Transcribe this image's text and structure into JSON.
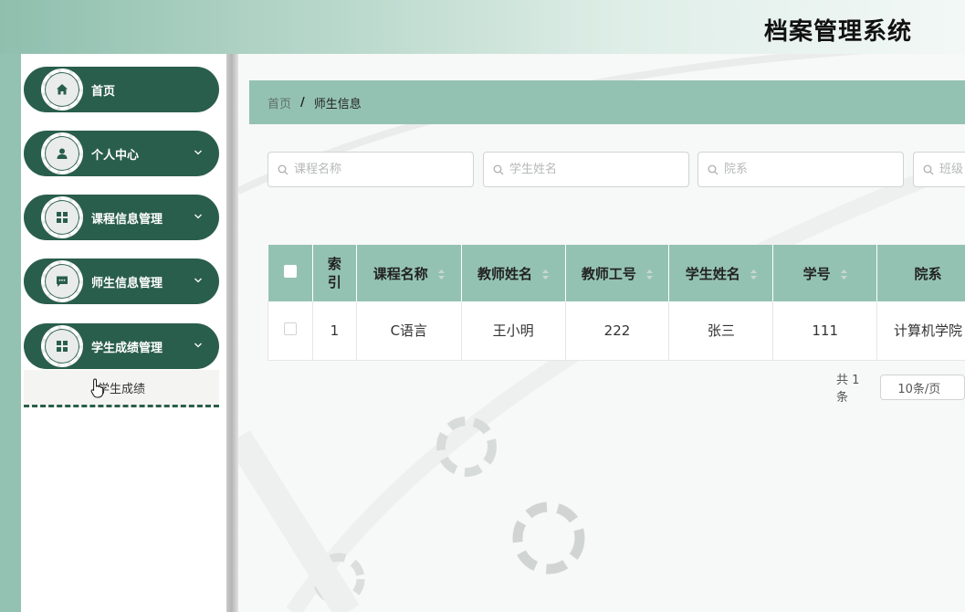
{
  "app": {
    "title": "档案管理系统"
  },
  "sidebar": {
    "items": [
      {
        "label": "首页",
        "icon": "home-icon",
        "has_arrow": false
      },
      {
        "label": "个人中心",
        "icon": "user-icon",
        "has_arrow": true
      },
      {
        "label": "课程信息管理",
        "icon": "grid-icon",
        "has_arrow": true
      },
      {
        "label": "师生信息管理",
        "icon": "chat-icon",
        "has_arrow": true
      },
      {
        "label": "学生成绩管理",
        "icon": "grid-icon",
        "has_arrow": true
      }
    ],
    "submenu": {
      "label": "学生成绩"
    }
  },
  "breadcrumb": {
    "home": "首页",
    "separator": "/",
    "current": "师生信息"
  },
  "search": [
    {
      "placeholder": "课程名称"
    },
    {
      "placeholder": "学生姓名"
    },
    {
      "placeholder": "院系"
    },
    {
      "placeholder": "班级"
    }
  ],
  "table": {
    "headers": [
      "索\n引",
      "课程名称",
      "教师姓名",
      "教师工号",
      "学生姓名",
      "学号",
      "院系"
    ],
    "header_index_line1": "索",
    "header_index_line2": "引",
    "rows": [
      {
        "index": "1",
        "course": "C语言",
        "teacher": "王小明",
        "teacher_id": "222",
        "student": "张三",
        "student_id": "111",
        "department": "计算机学院"
      }
    ]
  },
  "pager": {
    "total": "共 1 条",
    "page_size": "10条/页"
  },
  "colors": {
    "accent": "#2a5e4c",
    "header_green": "#94c2b2"
  }
}
